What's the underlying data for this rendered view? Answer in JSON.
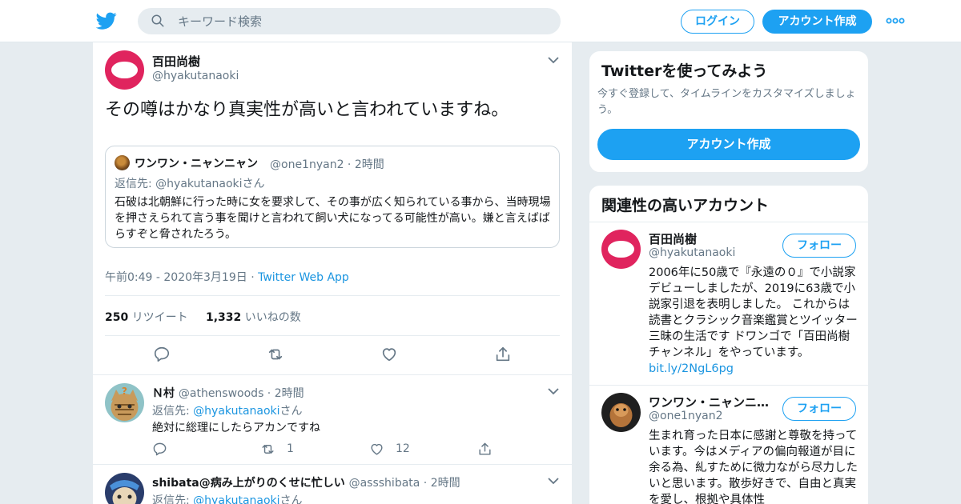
{
  "header": {
    "search_placeholder": "キーワード検索",
    "login_label": "ログイン",
    "signup_label": "アカウント作成"
  },
  "tweet": {
    "author_name": "百田尚樹",
    "author_handle": "@hyakutanaoki",
    "text": "その噂はかなり真実性が高いと言われていますね。",
    "quoted": {
      "author_name": "ワンワン・ニャンニャン",
      "author_handle": "@one1nyan2",
      "time": "2時間",
      "reply_to_prefix": "返信先: ",
      "reply_to_handle": "@hyakutanaoki",
      "reply_to_suffix": "さん",
      "text": "石破は北朝鮮に行った時に女を要求して、その事が広く知られている事から、当時現場を押さえられて言う事を聞けと言われて飼い犬になってる可能性が高い。嫌と言えばばらすぞと脅されたろう。"
    },
    "timestamp": "午前0:49 - 2020年3月19日",
    "source_app": "Twitter Web App",
    "retweet_count": "250",
    "retweet_label": "リツイート",
    "like_count": "1,332",
    "like_label": "いいねの数"
  },
  "replies": [
    {
      "author_name": "Ｎ村",
      "author_handle": "@athenswoods",
      "time": "2時間",
      "reply_to_prefix": "返信先: ",
      "reply_to_handle": "@hyakutanaoki",
      "reply_to_suffix": "さん",
      "text": "絶対に総理にしたらアカンですね",
      "retweets": "1",
      "likes": "12"
    },
    {
      "author_name": "shibata@病み上がりのくせに忙しい",
      "author_handle": "@assshibata",
      "time": "2時間",
      "reply_to_prefix": "返信先: ",
      "reply_to_handle": "@hyakutanaoki",
      "reply_to_suffix": "さん"
    }
  ],
  "sidebar": {
    "signup_card": {
      "title": "Twitterを使ってみよう",
      "subtitle": "今すぐ登録して、タイムラインをカスタマイズしましょう。",
      "button_label": "アカウント作成"
    },
    "related": {
      "title": "関連性の高いアカウント",
      "follow_label": "フォロー",
      "accounts": [
        {
          "name": "百田尚樹",
          "handle": "@hyakutanaoki",
          "bio": "2006年に50歳で『永遠の０』で小説家デビューしましたが、2019に63歳で小説家引退を表明しました。 これからは読書とクラシック音楽鑑賞とツイッター三昧の生活です ドワンゴで「百田尚樹チャンネル」をやっています。",
          "link": "bit.ly/2NgL6pg"
        },
        {
          "name": "ワンワン・ニャンニャン",
          "handle": "@one1nyan2",
          "bio": "生まれ育った日本に感謝と尊敬を持っています。今はメディアの偏向報道が目に余る為、糺すために微力ながら尽力したいと思います。散歩好きで、自由と真実を愛し、根拠や具体性"
        }
      ]
    }
  },
  "colors": {
    "brand": "#1da1f2",
    "link": "#1b95e0",
    "muted": "#657786",
    "avatar_hyaku": "#e0245e"
  }
}
